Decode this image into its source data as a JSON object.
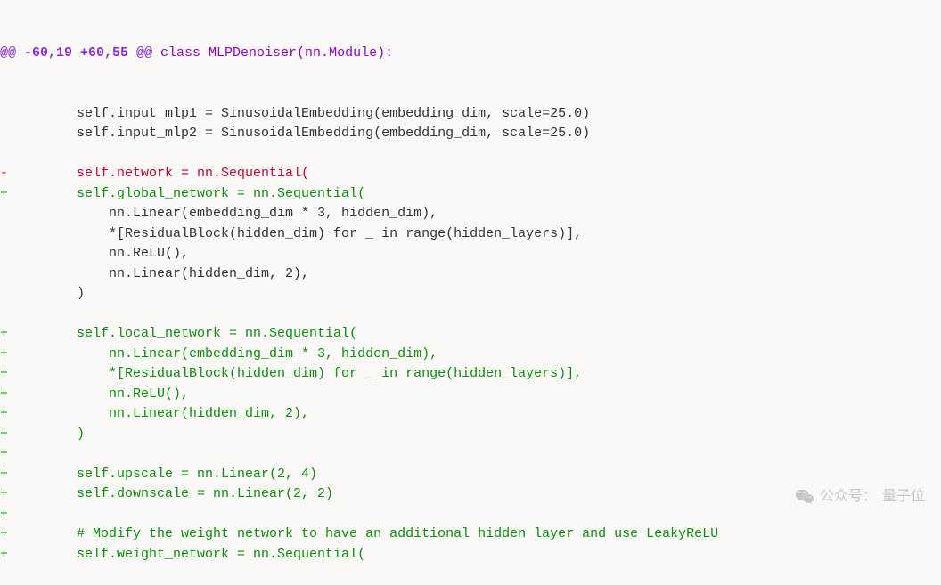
{
  "diff": {
    "hunk_header": "@@ -60,19 +60,55 @@",
    "hunk_context": " class MLPDenoiser(nn.Module):",
    "lines": [
      {
        "type": "context",
        "marker": " ",
        "text": "        self.input_mlp1 = SinusoidalEmbedding(embedding_dim, scale=25.0)"
      },
      {
        "type": "context",
        "marker": " ",
        "text": "        self.input_mlp2 = SinusoidalEmbedding(embedding_dim, scale=25.0)"
      },
      {
        "type": "context",
        "marker": " ",
        "text": ""
      },
      {
        "type": "del",
        "marker": "-",
        "text": "        self.network = nn.Sequential("
      },
      {
        "type": "add",
        "marker": "+",
        "text": "        self.global_network = nn.Sequential("
      },
      {
        "type": "context",
        "marker": " ",
        "text": "            nn.Linear(embedding_dim * 3, hidden_dim),"
      },
      {
        "type": "context",
        "marker": " ",
        "text": "            *[ResidualBlock(hidden_dim) for _ in range(hidden_layers)],"
      },
      {
        "type": "context",
        "marker": " ",
        "text": "            nn.ReLU(),"
      },
      {
        "type": "context",
        "marker": " ",
        "text": "            nn.Linear(hidden_dim, 2),"
      },
      {
        "type": "context",
        "marker": " ",
        "text": "        )"
      },
      {
        "type": "context",
        "marker": " ",
        "text": ""
      },
      {
        "type": "add",
        "marker": "+",
        "text": "        self.local_network = nn.Sequential("
      },
      {
        "type": "add",
        "marker": "+",
        "text": "            nn.Linear(embedding_dim * 3, hidden_dim),"
      },
      {
        "type": "add",
        "marker": "+",
        "text": "            *[ResidualBlock(hidden_dim) for _ in range(hidden_layers)],"
      },
      {
        "type": "add",
        "marker": "+",
        "text": "            nn.ReLU(),"
      },
      {
        "type": "add",
        "marker": "+",
        "text": "            nn.Linear(hidden_dim, 2),"
      },
      {
        "type": "add",
        "marker": "+",
        "text": "        )"
      },
      {
        "type": "add",
        "marker": "+",
        "text": ""
      },
      {
        "type": "add",
        "marker": "+",
        "text": "        self.upscale = nn.Linear(2, 4)"
      },
      {
        "type": "add",
        "marker": "+",
        "text": "        self.downscale = nn.Linear(2, 2)"
      },
      {
        "type": "add",
        "marker": "+",
        "text": ""
      },
      {
        "type": "add",
        "marker": "+",
        "text": "        # Modify the weight network to have an additional hidden layer and use LeakyReLU"
      },
      {
        "type": "add",
        "marker": "+",
        "text": "        self.weight_network = nn.Sequential("
      }
    ]
  },
  "watermark": {
    "prefix": "公众号：",
    "name": "量子位"
  }
}
